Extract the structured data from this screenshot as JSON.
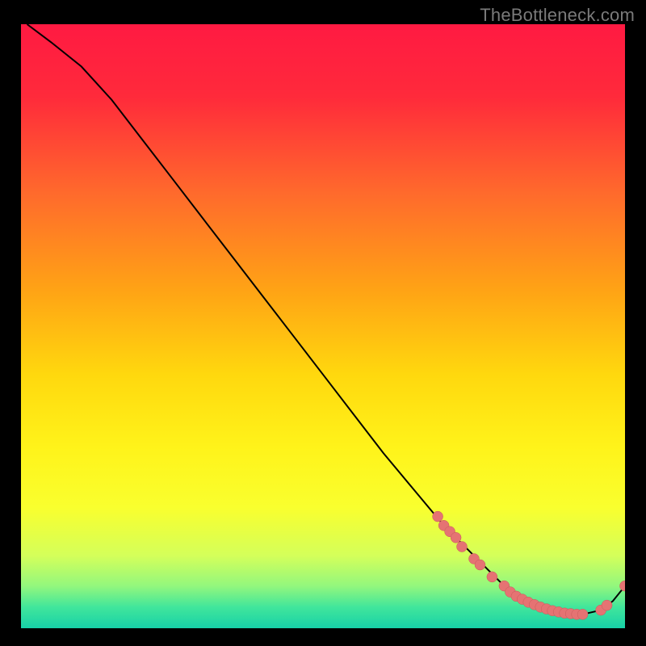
{
  "watermark": "TheBottleneck.com",
  "colors": {
    "gradient_stops": [
      {
        "offset": 0.0,
        "color": "#ff1a42"
      },
      {
        "offset": 0.12,
        "color": "#ff2a3b"
      },
      {
        "offset": 0.28,
        "color": "#ff6a2c"
      },
      {
        "offset": 0.44,
        "color": "#ffa315"
      },
      {
        "offset": 0.58,
        "color": "#ffd80e"
      },
      {
        "offset": 0.7,
        "color": "#fff31a"
      },
      {
        "offset": 0.8,
        "color": "#f9ff2e"
      },
      {
        "offset": 0.88,
        "color": "#d4ff5a"
      },
      {
        "offset": 0.93,
        "color": "#93f77d"
      },
      {
        "offset": 0.965,
        "color": "#41e69b"
      },
      {
        "offset": 1.0,
        "color": "#17d1a8"
      }
    ],
    "curve": "#000000",
    "marker_fill": "#e57373",
    "marker_stroke": "#c85a5a"
  },
  "chart_data": {
    "type": "line",
    "title": "",
    "xlabel": "",
    "ylabel": "",
    "xlim": [
      0,
      100
    ],
    "ylim": [
      0,
      100
    ],
    "grid": false,
    "legend": false,
    "series": [
      {
        "name": "bottleneck-curve",
        "x": [
          1,
          5,
          10,
          15,
          20,
          25,
          30,
          35,
          40,
          45,
          50,
          55,
          60,
          65,
          70,
          72,
          75,
          78,
          80,
          82,
          85,
          88,
          90,
          93,
          96,
          98,
          100
        ],
        "y": [
          100,
          97,
          93,
          87.5,
          81,
          74.5,
          68,
          61.5,
          55,
          48.5,
          42,
          35.5,
          29,
          23,
          17,
          15,
          12,
          9,
          7,
          5.5,
          4,
          3,
          2.5,
          2.3,
          3,
          4.5,
          7
        ]
      }
    ],
    "markers": [
      {
        "x": 69,
        "y": 18.5
      },
      {
        "x": 70,
        "y": 17
      },
      {
        "x": 71,
        "y": 16
      },
      {
        "x": 72,
        "y": 15
      },
      {
        "x": 73,
        "y": 13.5
      },
      {
        "x": 75,
        "y": 11.5
      },
      {
        "x": 76,
        "y": 10.5
      },
      {
        "x": 78,
        "y": 8.5
      },
      {
        "x": 80,
        "y": 7
      },
      {
        "x": 81,
        "y": 6
      },
      {
        "x": 82,
        "y": 5.3
      },
      {
        "x": 83,
        "y": 4.8
      },
      {
        "x": 84,
        "y": 4.3
      },
      {
        "x": 85,
        "y": 3.9
      },
      {
        "x": 86,
        "y": 3.5
      },
      {
        "x": 87,
        "y": 3.2
      },
      {
        "x": 88,
        "y": 2.9
      },
      {
        "x": 89,
        "y": 2.7
      },
      {
        "x": 90,
        "y": 2.5
      },
      {
        "x": 91,
        "y": 2.4
      },
      {
        "x": 92,
        "y": 2.3
      },
      {
        "x": 93,
        "y": 2.3
      },
      {
        "x": 96,
        "y": 3
      },
      {
        "x": 97,
        "y": 3.8
      },
      {
        "x": 100,
        "y": 7
      }
    ]
  }
}
